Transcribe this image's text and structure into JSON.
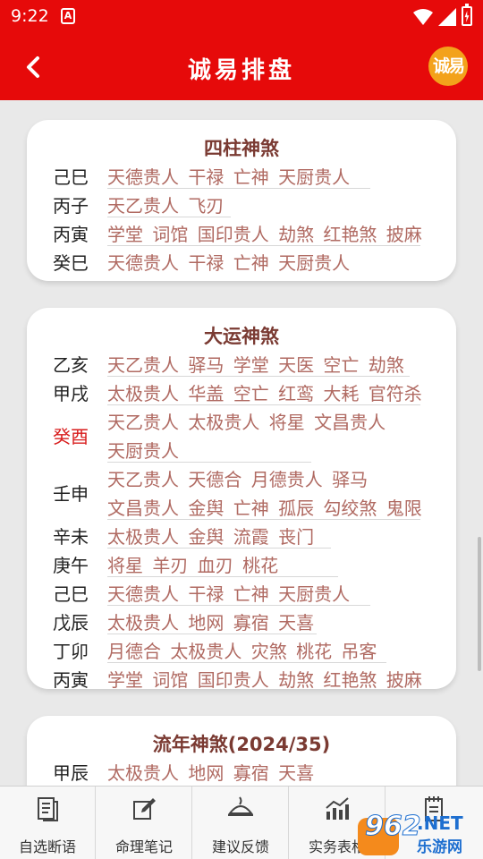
{
  "status_bar": {
    "time": "9:22",
    "app_icon_letter": "A"
  },
  "header": {
    "title": "诚易排盘",
    "logo_text": "诚易",
    "background": "#e60a0a"
  },
  "cards": [
    {
      "title": "四柱神煞",
      "rows": [
        {
          "gz": "己巳",
          "values": "天德贵人 干禄 亡神 天厨贵人"
        },
        {
          "gz": "丙子",
          "values": "天乙贵人 飞刃"
        },
        {
          "gz": "丙寅",
          "values": "学堂 词馆 国印贵人 劫煞 红艳煞 披麻"
        },
        {
          "gz": "癸巳",
          "values": "天德贵人 干禄 亡神 天厨贵人"
        }
      ]
    },
    {
      "title": "大运神煞",
      "rows": [
        {
          "gz": "乙亥",
          "values": "天乙贵人 驿马 学堂 天医 空亡 劫煞"
        },
        {
          "gz": "甲戌",
          "values": "太极贵人 华盖 空亡 红鸾 大耗 官符杀"
        },
        {
          "gz": "癸酉",
          "highlight": true,
          "values": "天乙贵人 太极贵人 将星 文昌贵人",
          "values2": "天厨贵人"
        },
        {
          "gz": "壬申",
          "values": "天乙贵人 天德合 月德贵人 驿马",
          "values2": "文昌贵人 金舆 亡神 孤辰 勾绞煞 鬼限"
        },
        {
          "gz": "辛未",
          "values": "太极贵人 金舆 流霞 丧门"
        },
        {
          "gz": "庚午",
          "values": "将星 羊刃 血刃 桃花"
        },
        {
          "gz": "己巳",
          "values": "天德贵人 干禄 亡神 天厨贵人"
        },
        {
          "gz": "戊辰",
          "values": "太极贵人 地网 寡宿 天喜"
        },
        {
          "gz": "丁卯",
          "values": "月德合 太极贵人 灾煞 桃花 吊客"
        },
        {
          "gz": "丙寅",
          "values": "学堂 词馆 国印贵人 劫煞 红艳煞 披麻"
        }
      ]
    },
    {
      "title": "流年神煞(2024/35)",
      "rows": [
        {
          "gz": "甲辰",
          "values": "太极贵人 地网 寡宿 天喜"
        }
      ]
    }
  ],
  "bottom_nav": [
    {
      "label": "自选断语",
      "icon": "document-icon"
    },
    {
      "label": "命理笔记",
      "icon": "edit-icon"
    },
    {
      "label": "建议反馈",
      "icon": "feedback-icon"
    },
    {
      "label": "实务表格",
      "icon": "chart-icon"
    },
    {
      "label": "",
      "icon": "notepad-icon"
    }
  ],
  "watermark": {
    "number": "962",
    "suffix": ".NET",
    "text": "乐游网"
  }
}
